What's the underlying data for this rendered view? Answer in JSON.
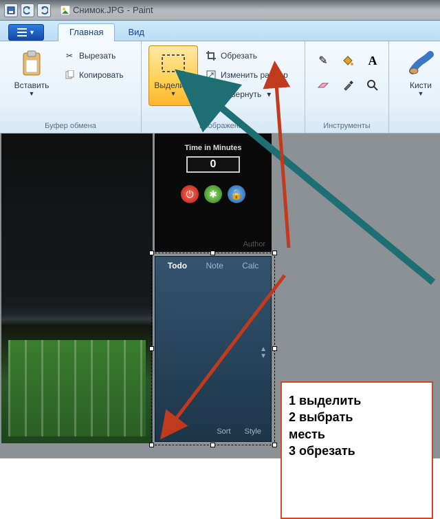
{
  "title": {
    "filename": "Снимок.JPG",
    "app": "Paint",
    "sep": " - "
  },
  "tabs": {
    "main": "Главная",
    "view": "Вид"
  },
  "clipboard": {
    "paste": "Вставить",
    "cut": "Вырезать",
    "copy": "Копировать",
    "group_label": "Буфер обмена"
  },
  "image": {
    "select": "Выделить",
    "crop": "Обрезать",
    "resize": "Изменить размер",
    "rotate": "Повернуть",
    "group_label": "Изображение"
  },
  "tools": {
    "brushes": "Кисти",
    "group_label": "Инструменты"
  },
  "gadget_timer": {
    "label": "Time in Minutes",
    "value": "0",
    "author": "Author"
  },
  "gadget_notes": {
    "tabs": {
      "todo": "Todo",
      "note": "Note",
      "calc": "Calc"
    },
    "footer": {
      "sort": "Sort",
      "style": "Style"
    }
  },
  "instructions": {
    "l1": "1 выделить",
    "l2": "2 выбрать",
    "l3": "месть",
    "l4": "3 обрезать"
  }
}
